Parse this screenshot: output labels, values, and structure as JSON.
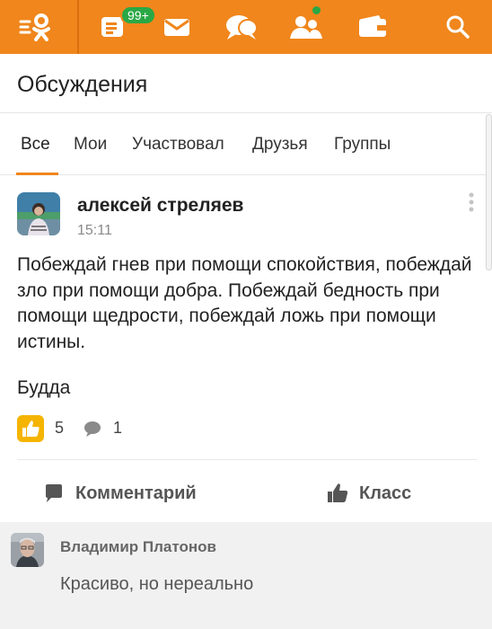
{
  "topbar": {
    "background": "#f0861c",
    "icons": [
      "ok-logo-icon",
      "feed-icon",
      "messages-icon",
      "discussions-icon",
      "friends-icon",
      "wallet-icon",
      "search-icon"
    ],
    "feed_badge": "99+"
  },
  "header": {
    "title": "Обсуждения"
  },
  "tabs": [
    {
      "label": "Все",
      "active": true
    },
    {
      "label": "Мои",
      "active": false
    },
    {
      "label": "Участвовал",
      "active": false
    },
    {
      "label": "Друзья",
      "active": false
    },
    {
      "label": "Группы",
      "active": false
    }
  ],
  "post": {
    "author": "алексей стреляев",
    "time": "15:11",
    "text": "Побеждай гнев при помощи спокойствия, побеждай зло при помощи добра. Побеждай бедность при помощи щедрости, побеждай ложь при помощи истины.",
    "signature": "Будда",
    "likes": "5",
    "comments": "1"
  },
  "actions": {
    "comment_label": "Комментарий",
    "like_label": "Класс"
  },
  "comment": {
    "author": "Владимир Платонов",
    "text": "Красиво, но нереально"
  },
  "colors": {
    "accent": "#f0861c",
    "badge": "#2aa845",
    "like": "#f5b400"
  }
}
